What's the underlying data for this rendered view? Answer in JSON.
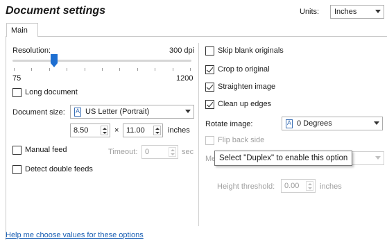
{
  "title": "Document settings",
  "units": {
    "label": "Units:",
    "value": "Inches"
  },
  "tabs": [
    {
      "label": "Main"
    }
  ],
  "resolution": {
    "label": "Resolution:",
    "value_text": "300 dpi",
    "min_text": "75",
    "max_text": "1200",
    "slider_level": 0.23
  },
  "long_document": {
    "label": "Long document",
    "checked": false
  },
  "document_size": {
    "label": "Document size:",
    "value": "US Letter (Portrait)",
    "width": "8.50",
    "times": "×",
    "height": "11.00",
    "unit": "inches"
  },
  "manual_feed": {
    "label": "Manual feed",
    "checked": false,
    "timeout_label": "Timeout:",
    "timeout_value": "0",
    "timeout_unit": "sec"
  },
  "detect_double_feeds": {
    "label": "Detect double feeds",
    "checked": false
  },
  "skip_blank": {
    "label": "Skip blank originals",
    "checked": false
  },
  "crop": {
    "label": "Crop to original",
    "checked": true
  },
  "straighten": {
    "label": "Straighten image",
    "checked": true
  },
  "clean_edges": {
    "label": "Clean up edges",
    "checked": true
  },
  "rotate": {
    "label": "Rotate image:",
    "value": "0 Degrees"
  },
  "flip": {
    "label": "Flip back side",
    "checked": false
  },
  "me_partial": "Me",
  "tooltip": "Select \"Duplex\" to enable this option",
  "height_threshold": {
    "label": "Height threshold:",
    "value": "0.00",
    "unit": "inches"
  },
  "help_link": "Help me choose values for these options",
  "colors": {
    "accent": "#1f6fd1",
    "link": "#1a5fb4",
    "disabled": "#a0a0a0"
  }
}
